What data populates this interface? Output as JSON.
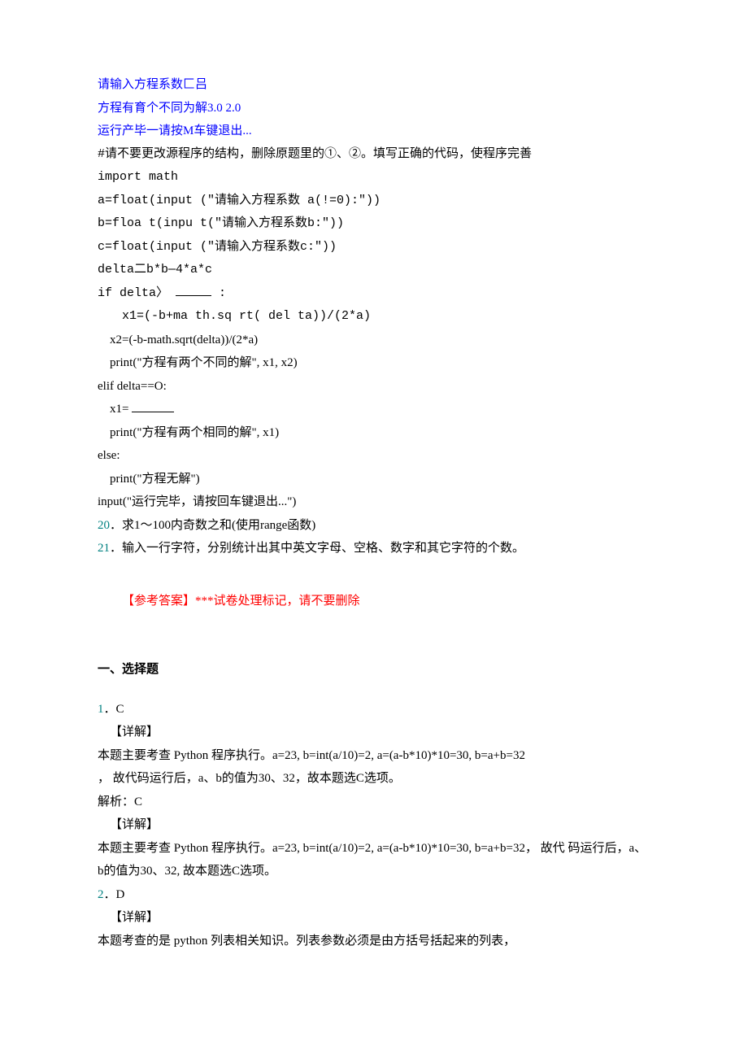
{
  "header_blue": {
    "l1": "请输入方程系数匚吕",
    "l2": "方程有育个不同为解3.0 2.0",
    "l3": "运行产毕一请按M车键退出..."
  },
  "code_block": {
    "comment": "#请不要更改源程序的结构，删除原题里的①、②。填写正确的代码，使程序完善",
    "import": "import math",
    "a_line": "a=float(input (\"请输入方程系数 a(!=0):\"))",
    "b_line": "b=floa t(inpu t(\"请输入方程系数b:\"))",
    "c_line": "c=float(input (\"请输入方程系数c:\"))",
    "delta": "delta二b*b—4*a*c",
    "if_prefix": "if delta〉",
    "if_suffix": ":",
    "x1a": "x1=(-b+ma th.sq rt( del ta))/(2*a)",
    "x2a": "x2=(-b-math.sqrt(delta))/(2*a)",
    "print1": "print(\"方程有两个不同的解\", x1,  x2)",
    "elif": "elif delta==O:",
    "x1b_prefix": "x1=",
    "print2": "print(\"方程有两个相同的解\",  x1)",
    "else": "else:",
    "print3": "print(\"方程无解\")",
    "input_end": "input(\"运行完毕，请按回车键退出...\")"
  },
  "questions": {
    "q20_num": "20",
    "q20_text": "．求1～100内奇数之和(使用range函数)",
    "q21_num": "21",
    "q21_text": "．输入一行字符，分别统计出其中英文字母、空格、数字和其它字符的个数。"
  },
  "answers_header": "【参考答案】***试卷处理标记，请不要删除",
  "section_header": "一、选择题",
  "ans1": {
    "num": "1",
    "label": "．C",
    "detail_tag": "【详解】",
    "detail_body": "本题主要考查 Python 程序执行。a=23,  b=int(a/10)=2, a=(a-b*10)*10=30, b=a+b=32",
    "detail_body2": "， 故代码运行后，a、b的值为30、32，故本题选C选项。",
    "jie_label": "解析：C",
    "detail_tag2": "【详解】",
    "detail2_body": "本题主要考查 Python 程序执行。a=23,   b=int(a/10)=2,  a=(a-b*10)*10=30,  b=a+b=32， 故代 码运行后，a、b的值为30、32, 故本题选C选项。"
  },
  "ans2": {
    "num": "2",
    "label": "．D",
    "detail_tag": "【详解】",
    "detail_body": "本题考查的是  python 列表相关知识。列表参数必须是由方括号括起来的列表，"
  }
}
